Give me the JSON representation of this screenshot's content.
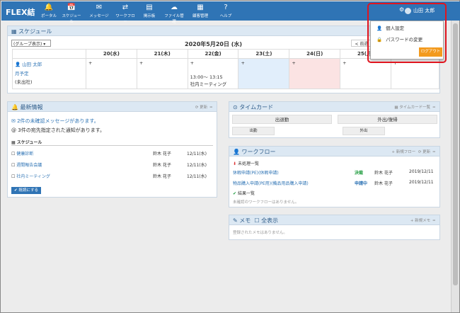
{
  "app": {
    "logo": "FLEX結"
  },
  "nav": [
    {
      "label": "ポータル",
      "icon": "🔔"
    },
    {
      "label": "スケジュール",
      "icon": "📅"
    },
    {
      "label": "メッセージ",
      "icon": "✉"
    },
    {
      "label": "ワークフロー",
      "icon": "⇄"
    },
    {
      "label": "掲示板",
      "icon": "▤"
    },
    {
      "label": "ファイル管理",
      "icon": "☁"
    },
    {
      "label": "顧客管理",
      "icon": "▦"
    },
    {
      "label": "ヘルプ",
      "icon": "?"
    }
  ],
  "user": {
    "name": "山田 太郎"
  },
  "popup": {
    "personal": "個人設定",
    "password": "パスワードの変更",
    "logout": "ログアウト"
  },
  "schedule": {
    "title": "スケジュール",
    "group_select": "(グループ表示)",
    "date": "2020年5月20日 (水)",
    "prev": "< 前週",
    "days": [
      "20(水)",
      "21(木)",
      "22(金)",
      "23(土)",
      "24(日)",
      "25(月)",
      "26"
    ],
    "person": "山田 太郎",
    "person_plan": "月予定",
    "person_status": "(未出社)",
    "event_time": "13:00～ 13:15",
    "event_title": "社内ミーティング"
  },
  "news": {
    "title": "最新情報",
    "refresh": "更新",
    "msg1": "2件の未確認メッセージがあります。",
    "msg2": "3件の宛先指定された通知があります。",
    "section": "スケジュール",
    "items": [
      {
        "name": "健康診断",
        "who": "鈴木 花子",
        "date": "12/11(水)"
      },
      {
        "name": "週間報告会議",
        "who": "鈴木 花子",
        "date": "12/11(水)"
      },
      {
        "name": "社内ミーティング",
        "who": "鈴木 花子",
        "date": "12/11(水)"
      }
    ],
    "confirm": "既読にする"
  },
  "timecard": {
    "title": "タイムカード",
    "list": "タイムカード一覧",
    "in": "出退勤",
    "out": "外出/復帰",
    "in_sub": "出勤",
    "out_sub": "外出"
  },
  "workflow": {
    "title": "ワークフロー",
    "new": "新規フロー",
    "refresh": "更新",
    "pending": "未処理一覧",
    "items": [
      {
        "name": "休暇申請(PE)(休暇申請)",
        "status": "決裁",
        "who": "鈴木 花子",
        "date": "2019/12/11"
      },
      {
        "name": "物品購入申請(PE用)(備品用品購入申請)",
        "status": "申請中",
        "who": "鈴木 花子",
        "date": "2019/12/11"
      }
    ],
    "done": "結果一覧",
    "done_empty": "未確認のワークフローはありません。"
  },
  "memo": {
    "title": "メモ",
    "showall": "全表示",
    "new": "新規メモ",
    "empty": "登録されたメモはありません。"
  }
}
